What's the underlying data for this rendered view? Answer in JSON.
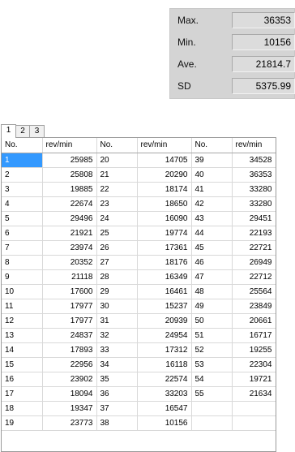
{
  "stats": [
    {
      "label": "Max.",
      "value": "36353"
    },
    {
      "label": "Min.",
      "value": "10156"
    },
    {
      "label": "Ave.",
      "value": "21814.7"
    },
    {
      "label": "SD",
      "value": "5375.99"
    }
  ],
  "tabs": [
    "1",
    "2",
    "3"
  ],
  "grid": {
    "headers": [
      "No.",
      "rev/min",
      "No.",
      "rev/min",
      "No.",
      "rev/min"
    ],
    "rows": [
      [
        "1",
        "25985",
        "20",
        "14705",
        "39",
        "34528"
      ],
      [
        "2",
        "25808",
        "21",
        "20290",
        "40",
        "36353"
      ],
      [
        "3",
        "19885",
        "22",
        "18174",
        "41",
        "33280"
      ],
      [
        "4",
        "22674",
        "23",
        "18650",
        "42",
        "33280"
      ],
      [
        "5",
        "29496",
        "24",
        "16090",
        "43",
        "29451"
      ],
      [
        "6",
        "21921",
        "25",
        "19774",
        "44",
        "22193"
      ],
      [
        "7",
        "23974",
        "26",
        "17361",
        "45",
        "22721"
      ],
      [
        "8",
        "20352",
        "27",
        "18176",
        "46",
        "26949"
      ],
      [
        "9",
        "21118",
        "28",
        "16349",
        "47",
        "22712"
      ],
      [
        "10",
        "17600",
        "29",
        "16461",
        "48",
        "25564"
      ],
      [
        "11",
        "17977",
        "30",
        "15237",
        "49",
        "23849"
      ],
      [
        "12",
        "17977",
        "31",
        "20939",
        "50",
        "20661"
      ],
      [
        "13",
        "24837",
        "32",
        "24954",
        "51",
        "16717"
      ],
      [
        "14",
        "17893",
        "33",
        "17312",
        "52",
        "19255"
      ],
      [
        "15",
        "22956",
        "34",
        "16118",
        "53",
        "22304"
      ],
      [
        "16",
        "23902",
        "35",
        "22574",
        "54",
        "19721"
      ],
      [
        "17",
        "18094",
        "36",
        "33203",
        "55",
        "21634"
      ],
      [
        "18",
        "19347",
        "37",
        "16547",
        "",
        ""
      ],
      [
        "19",
        "23773",
        "38",
        "10156",
        "",
        ""
      ]
    ]
  }
}
